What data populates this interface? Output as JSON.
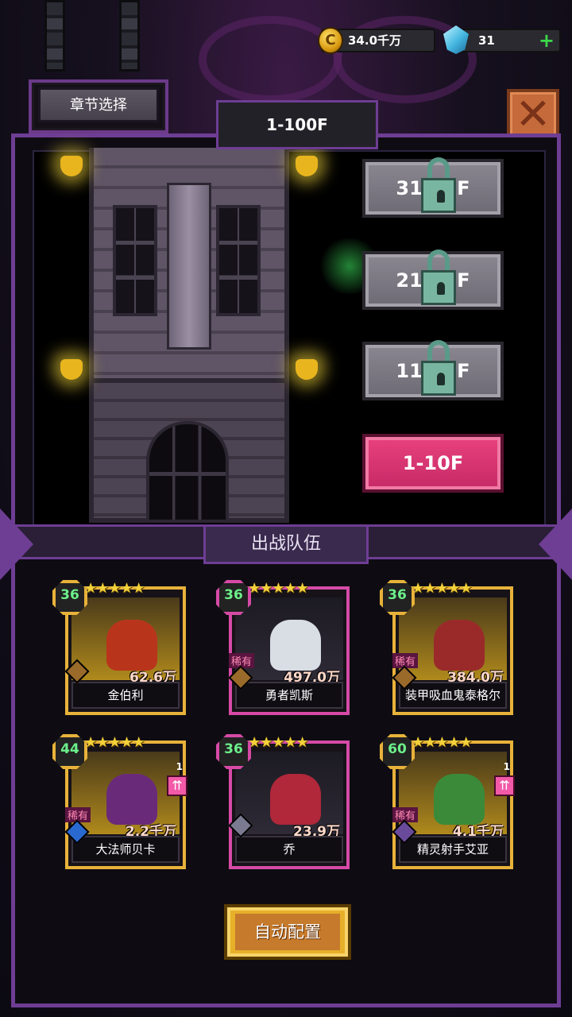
{
  "currency": {
    "gold_value": "34.0千万",
    "gems_value": "31",
    "gold_glyph": "C",
    "plus_glyph": "+"
  },
  "chapter_button_label": "章节选择",
  "close_glyph": "✕",
  "floor_range_title": "1-100F",
  "floors": [
    {
      "label": "31-40F",
      "locked": true
    },
    {
      "label": "21-30F",
      "locked": true
    },
    {
      "label": "11-20F",
      "locked": true
    },
    {
      "label": "1-10F",
      "locked": false,
      "selected": true
    }
  ],
  "team_title": "出战队伍",
  "heroes": [
    {
      "name": "金伯利",
      "level": "36",
      "power": "62.6万",
      "stars": "★★★★★",
      "rare": "",
      "frame": "gold"
    },
    {
      "name": "勇者凯斯",
      "level": "36",
      "power": "497.0万",
      "stars": "★★★★★",
      "rare": "稀有",
      "frame": "pink"
    },
    {
      "name": "装甲吸血鬼泰格尔",
      "level": "36",
      "power": "384.0万",
      "stars": "★★★★★",
      "rare": "稀有",
      "frame": "gold"
    },
    {
      "name": "大法师贝卡",
      "level": "44",
      "power": "2.2千万",
      "stars": "★★★★★",
      "rare": "稀有",
      "frame": "gold",
      "badge": "1"
    },
    {
      "name": "乔",
      "level": "36",
      "power": "23.9万",
      "stars": "★★★★★",
      "rare": "",
      "frame": "pink"
    },
    {
      "name": "精灵射手艾亚",
      "level": "60",
      "power": "4.1千万",
      "stars": "★★★★★",
      "rare": "稀有",
      "frame": "gold",
      "badge": "1"
    }
  ],
  "auto_button_label": "自动配置",
  "colors": {
    "frame_purple": "#6e3d94",
    "selected_pink": "#e8417e",
    "gold_frame": "#e8b23a",
    "pink_frame": "#d64aa6",
    "level_green": "#6cf08a"
  }
}
